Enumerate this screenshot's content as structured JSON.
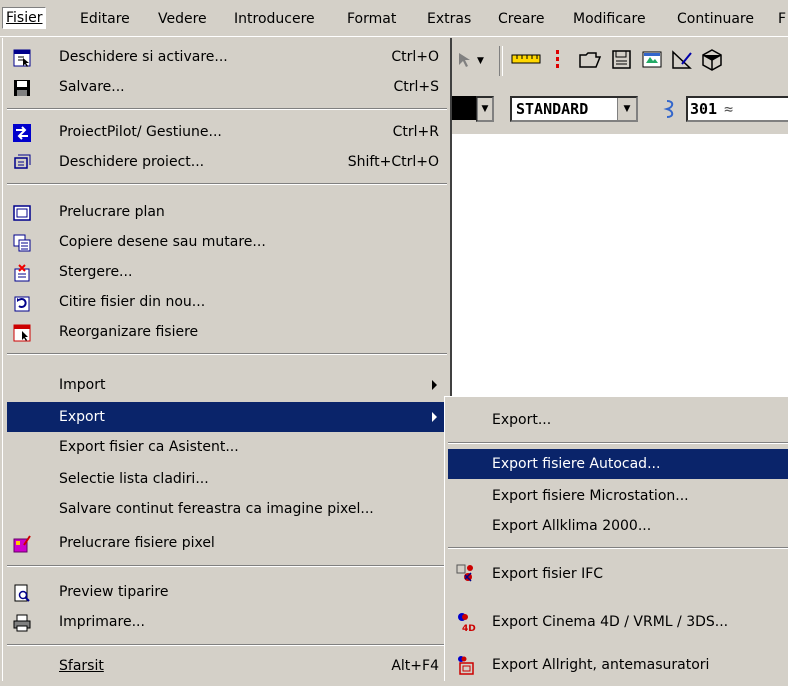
{
  "menubar": {
    "items": [
      {
        "label": "Fisier"
      },
      {
        "label": "Editare"
      },
      {
        "label": "Vedere"
      },
      {
        "label": "Introducere"
      },
      {
        "label": "Format"
      },
      {
        "label": "Extras"
      },
      {
        "label": "Creare"
      },
      {
        "label": "Modificare"
      },
      {
        "label": "Continuare"
      },
      {
        "label": "F"
      }
    ]
  },
  "toolbar": {
    "layer_combo": "STANDARD",
    "pen_combo": "301"
  },
  "file_menu": {
    "items": [
      {
        "label": "Deschidere si activare...",
        "shortcut": "Ctrl+O",
        "icon": "open-activate-icon"
      },
      {
        "label": "Salvare...",
        "shortcut": "Ctrl+S",
        "icon": "floppy-disk-icon"
      },
      {
        "label": "ProiectPilot/ Gestiune...",
        "shortcut": "Ctrl+R",
        "icon": "project-pilot-icon"
      },
      {
        "label": "Deschidere proiect...",
        "shortcut": "Shift+Ctrl+O",
        "icon": "open-project-icon"
      },
      {
        "label": "Prelucrare plan",
        "icon": "plan-icon"
      },
      {
        "label": "Copiere desene sau mutare...",
        "icon": "copy-drawings-icon"
      },
      {
        "label": "Stergere...",
        "icon": "delete-files-icon"
      },
      {
        "label": "Citire fisier din nou...",
        "icon": "reload-file-icon"
      },
      {
        "label": "Reorganizare fisiere",
        "icon": "reorganize-files-icon"
      },
      {
        "label": "Import"
      },
      {
        "label": "Export"
      },
      {
        "label": "Export fisier ca Asistent..."
      },
      {
        "label": "Selectie lista cladiri..."
      },
      {
        "label": "Salvare continut fereastra ca imagine pixel..."
      },
      {
        "label": "Prelucrare fisiere pixel",
        "icon": "pixel-edit-icon"
      },
      {
        "label": "Preview tiparire",
        "icon": "print-preview-icon"
      },
      {
        "label": "Imprimare...",
        "icon": "printer-icon"
      },
      {
        "label": "Sfarsit",
        "shortcut": "Alt+F4"
      }
    ]
  },
  "export_submenu": {
    "items": [
      {
        "label": "Export..."
      },
      {
        "label": "Export fisiere Autocad..."
      },
      {
        "label": "Export fisiere Microstation..."
      },
      {
        "label": "Export Allklima 2000..."
      },
      {
        "label": "Export  fisier IFC",
        "icon": "ifc-icon"
      },
      {
        "label": "Export Cinema 4D / VRML / 3DS...",
        "icon": "cinema4d-icon"
      },
      {
        "label": "Export Allright, antemasuratori",
        "icon": "allright-icon"
      }
    ]
  },
  "colors": {
    "highlight": "#0a246a",
    "menu_bg": "#d4d0c8"
  }
}
